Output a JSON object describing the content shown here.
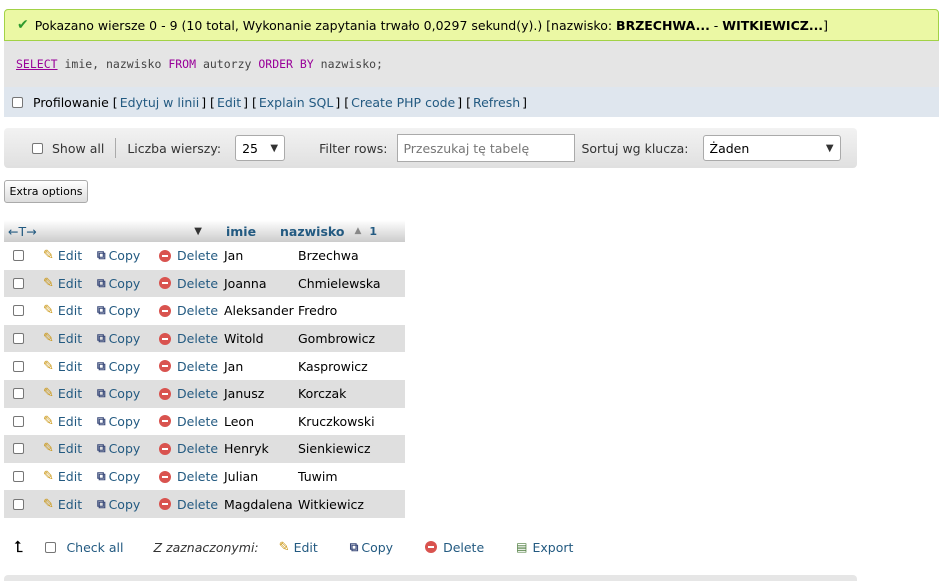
{
  "banner": {
    "text": "Pokazano wiersze 0 - 9 (10 total, Wykonanie zapytania trwało 0,0297 sekund(y).) [nazwisko: ",
    "bold1": "BRZECHWA...",
    "dash": " - ",
    "bold2": "WITKIEWICZ...",
    "end": "]"
  },
  "sql": {
    "select": "SELECT",
    "p1": " imie, nazwisko ",
    "from": "FROM",
    "p2": " autorzy ",
    "orderby": "ORDER BY",
    "p3": " nazwisko;"
  },
  "profiling": {
    "label": "Profilowanie",
    "links": [
      "Edytuj w linii",
      "Edit",
      "Explain SQL",
      "Create PHP code",
      "Refresh"
    ]
  },
  "navbar": {
    "show_all": "Show all",
    "rows_label": "Liczba wierszy:",
    "rows_value": "25",
    "filter_label": "Filter rows:",
    "filter_placeholder": "Przeszukaj tę tabelę",
    "sort_label": "Sortuj wg klucza:",
    "sort_value": "Żaden"
  },
  "extra_options": "Extra options",
  "table": {
    "columns": [
      "imie",
      "nazwisko"
    ],
    "sort_indicator": "1",
    "actions": {
      "edit": "Edit",
      "copy": "Copy",
      "delete": "Delete"
    },
    "rows": [
      {
        "imie": "Jan",
        "nazwisko": "Brzechwa"
      },
      {
        "imie": "Joanna",
        "nazwisko": "Chmielewska"
      },
      {
        "imie": "Aleksander",
        "nazwisko": "Fredro"
      },
      {
        "imie": "Witold",
        "nazwisko": "Gombrowicz"
      },
      {
        "imie": "Jan",
        "nazwisko": "Kasprowicz"
      },
      {
        "imie": "Janusz",
        "nazwisko": "Korczak"
      },
      {
        "imie": "Leon",
        "nazwisko": "Kruczkowski"
      },
      {
        "imie": "Henryk",
        "nazwisko": "Sienkiewicz"
      },
      {
        "imie": "Julian",
        "nazwisko": "Tuwim"
      },
      {
        "imie": "Magdalena",
        "nazwisko": "Witkiewicz"
      }
    ]
  },
  "bottom": {
    "check_all": "Check all",
    "with_selected": "Z zaznaczonymi:",
    "edit": "Edit",
    "copy": "Copy",
    "delete": "Delete",
    "export": "Export"
  }
}
